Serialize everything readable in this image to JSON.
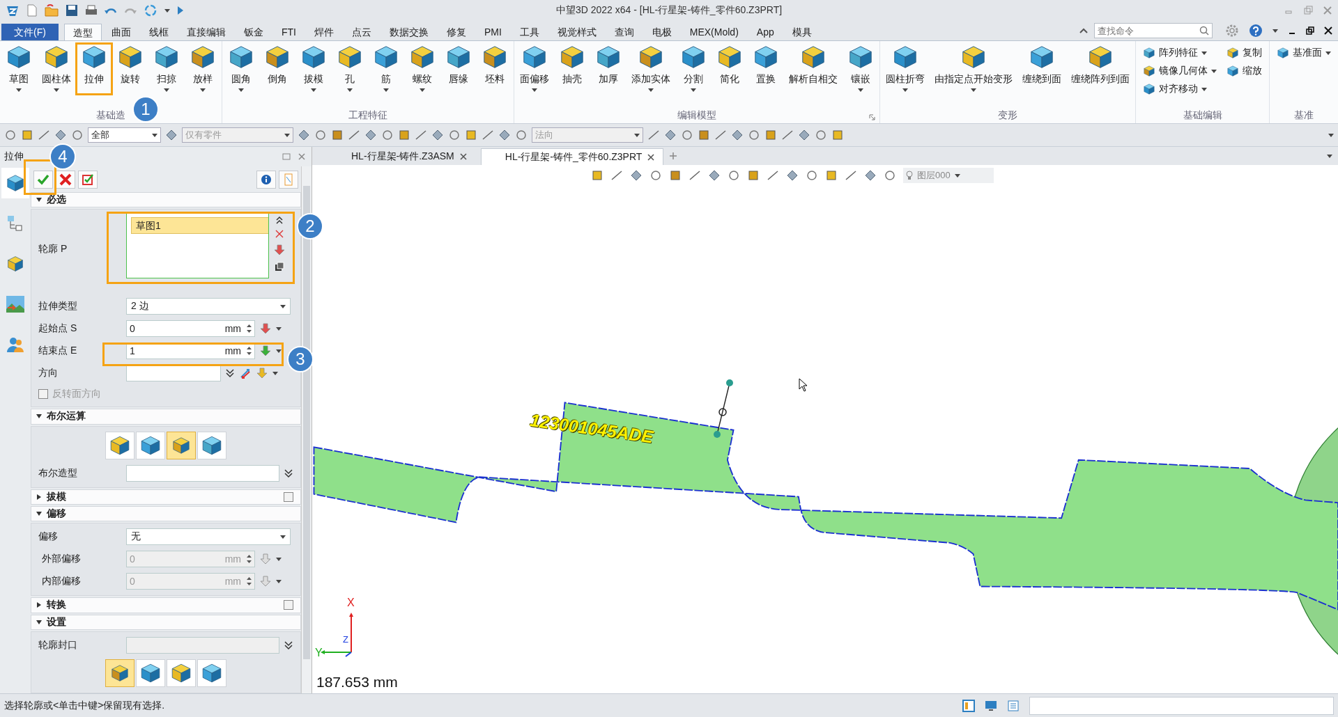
{
  "window": {
    "title": "中望3D 2022 x64 - [HL-行星架-铸件_零件60.Z3PRT]"
  },
  "menu_tabs": [
    {
      "label": "文件(F)",
      "kind": "file",
      "selected": false
    },
    {
      "label": "造型",
      "kind": "tab",
      "selected": true
    },
    {
      "label": "曲面",
      "kind": "tab",
      "selected": false
    },
    {
      "label": "线框",
      "kind": "tab",
      "selected": false
    },
    {
      "label": "直接编辑",
      "kind": "tab",
      "selected": false
    },
    {
      "label": "钣金",
      "kind": "tab",
      "selected": false
    },
    {
      "label": "FTI",
      "kind": "tab",
      "selected": false
    },
    {
      "label": "焊件",
      "kind": "tab",
      "selected": false
    },
    {
      "label": "点云",
      "kind": "tab",
      "selected": false
    },
    {
      "label": "数据交换",
      "kind": "tab",
      "selected": false
    },
    {
      "label": "修复",
      "kind": "tab",
      "selected": false
    },
    {
      "label": "PMI",
      "kind": "tab",
      "selected": false
    },
    {
      "label": "工具",
      "kind": "tab",
      "selected": false
    },
    {
      "label": "视觉样式",
      "kind": "tab",
      "selected": false
    },
    {
      "label": "查询",
      "kind": "tab",
      "selected": false
    },
    {
      "label": "电极",
      "kind": "tab",
      "selected": false
    },
    {
      "label": "MEX(Mold)",
      "kind": "tab",
      "selected": false
    },
    {
      "label": "App",
      "kind": "tab",
      "selected": false
    },
    {
      "label": "模具",
      "kind": "tab",
      "selected": false
    }
  ],
  "search": {
    "placeholder": "查找命令"
  },
  "ribbon_groups": [
    {
      "label": "基础造",
      "kind": "large",
      "tools": [
        {
          "label": "草图",
          "dropdown": true
        },
        {
          "label": "圆柱体",
          "dropdown": true
        },
        {
          "label": "拉伸",
          "dropdown": false
        },
        {
          "label": "旋转",
          "dropdown": false
        },
        {
          "label": "扫掠",
          "dropdown": true
        },
        {
          "label": "放样",
          "dropdown": true
        }
      ]
    },
    {
      "label": "工程特征",
      "kind": "large",
      "tools": [
        {
          "label": "圆角",
          "dropdown": true
        },
        {
          "label": "倒角",
          "dropdown": false
        },
        {
          "label": "拔模",
          "dropdown": true
        },
        {
          "label": "孔",
          "dropdown": true
        },
        {
          "label": "筋",
          "dropdown": true
        },
        {
          "label": "螺纹",
          "dropdown": true
        },
        {
          "label": "唇缘",
          "dropdown": false
        },
        {
          "label": "坯料",
          "dropdown": false
        }
      ]
    },
    {
      "label": "编辑模型",
      "kind": "large",
      "tools": [
        {
          "label": "面偏移",
          "dropdown": true
        },
        {
          "label": "抽壳",
          "dropdown": false
        },
        {
          "label": "加厚",
          "dropdown": false
        },
        {
          "label": "添加实体",
          "dropdown": true
        },
        {
          "label": "分割",
          "dropdown": true
        },
        {
          "label": "简化",
          "dropdown": false
        },
        {
          "label": "置换",
          "dropdown": false
        },
        {
          "label": "解析自相交",
          "dropdown": false
        },
        {
          "label": "镶嵌",
          "dropdown": true
        }
      ]
    },
    {
      "label": "变形",
      "kind": "large",
      "tools": [
        {
          "label": "圆柱折弯",
          "dropdown": true
        },
        {
          "label": "由指定点开始变形",
          "dropdown": true
        },
        {
          "label": "缠绕到面",
          "dropdown": false
        },
        {
          "label": "缠绕阵列到面",
          "dropdown": false
        }
      ]
    },
    {
      "label": "基础编辑",
      "kind": "small",
      "tools": [
        {
          "label": "阵列特征",
          "dropdown": true
        },
        {
          "label": "镜像几何体",
          "dropdown": true
        },
        {
          "label": "对齐移动",
          "dropdown": true
        },
        {
          "label": "复制",
          "dropdown": false
        },
        {
          "label": "缩放",
          "dropdown": false
        }
      ]
    },
    {
      "label": "基准",
      "kind": "small",
      "tools": [
        {
          "label": "基准面",
          "dropdown": true
        }
      ]
    }
  ],
  "toolbar": {
    "dropdowns": [
      {
        "value": "全部",
        "disabled": false
      },
      {
        "value": "仅有零件",
        "disabled": true
      },
      {
        "value": "法向",
        "disabled": true
      }
    ]
  },
  "panel": {
    "title": "拉伸",
    "side_tabs": [
      {
        "selected": true
      },
      {
        "selected": false
      },
      {
        "selected": false
      },
      {
        "selected": false
      },
      {
        "selected": false
      }
    ],
    "sections": [
      {
        "title": "必选",
        "expanded": true,
        "rows": [
          {
            "kind": "list",
            "label": "轮廓 P",
            "items": [
              {
                "label": "草图1",
                "selected": true
              }
            ]
          },
          {
            "kind": "select",
            "label": "拉伸类型",
            "value": "2 边",
            "disabled": false
          },
          {
            "kind": "number",
            "label": "起始点 S",
            "value": "0",
            "unit": "mm",
            "disabled": false
          },
          {
            "kind": "number",
            "label": "结束点 E",
            "value": "1",
            "unit": "mm",
            "disabled": false
          },
          {
            "kind": "text",
            "label": "方向",
            "value": ""
          },
          {
            "kind": "checkbox",
            "label": "反转面方向",
            "checked": false,
            "disabled": true
          }
        ]
      },
      {
        "title": "布尔运算",
        "expanded": true,
        "rows": [
          {
            "kind": "icons",
            "options": [
              {
                "selected": false
              },
              {
                "selected": false
              },
              {
                "selected": true
              },
              {
                "selected": false
              }
            ]
          },
          {
            "kind": "text",
            "label": "布尔造型",
            "value": ""
          }
        ]
      },
      {
        "title": "拔模",
        "expanded": false,
        "checked": false
      },
      {
        "title": "偏移",
        "expanded": true,
        "rows": [
          {
            "kind": "select",
            "label": "偏移",
            "value": "无",
            "disabled": false
          },
          {
            "kind": "number",
            "label": "外部偏移",
            "value": "0",
            "unit": "mm",
            "disabled": true
          },
          {
            "kind": "number",
            "label": "内部偏移",
            "value": "0",
            "unit": "mm",
            "disabled": true
          }
        ]
      },
      {
        "title": "转换",
        "expanded": false,
        "checked": false
      },
      {
        "title": "设置",
        "expanded": true,
        "rows": [
          {
            "kind": "text",
            "label": "轮廓封口",
            "value": "",
            "disabled": true
          },
          {
            "kind": "icons",
            "options": [
              {
                "selected": true
              },
              {
                "selected": false
              },
              {
                "selected": false
              },
              {
                "selected": false
              }
            ]
          }
        ]
      }
    ]
  },
  "doc_tabs": [
    {
      "label": "HL-行星架-铸件.Z3ASM",
      "selected": false
    },
    {
      "label": "HL-行星架-铸件_零件60.Z3PRT",
      "selected": true
    }
  ],
  "viewport": {
    "layer": "图层000",
    "engraving": "123001045ADE",
    "axes": {
      "x": "X",
      "y": "Y",
      "z": "Z"
    },
    "scale": "187.653 mm"
  },
  "status_bar": {
    "message": "选择轮廓或<单击中键>保留现有选择."
  },
  "annotations": [
    "1",
    "2",
    "3",
    "4"
  ]
}
